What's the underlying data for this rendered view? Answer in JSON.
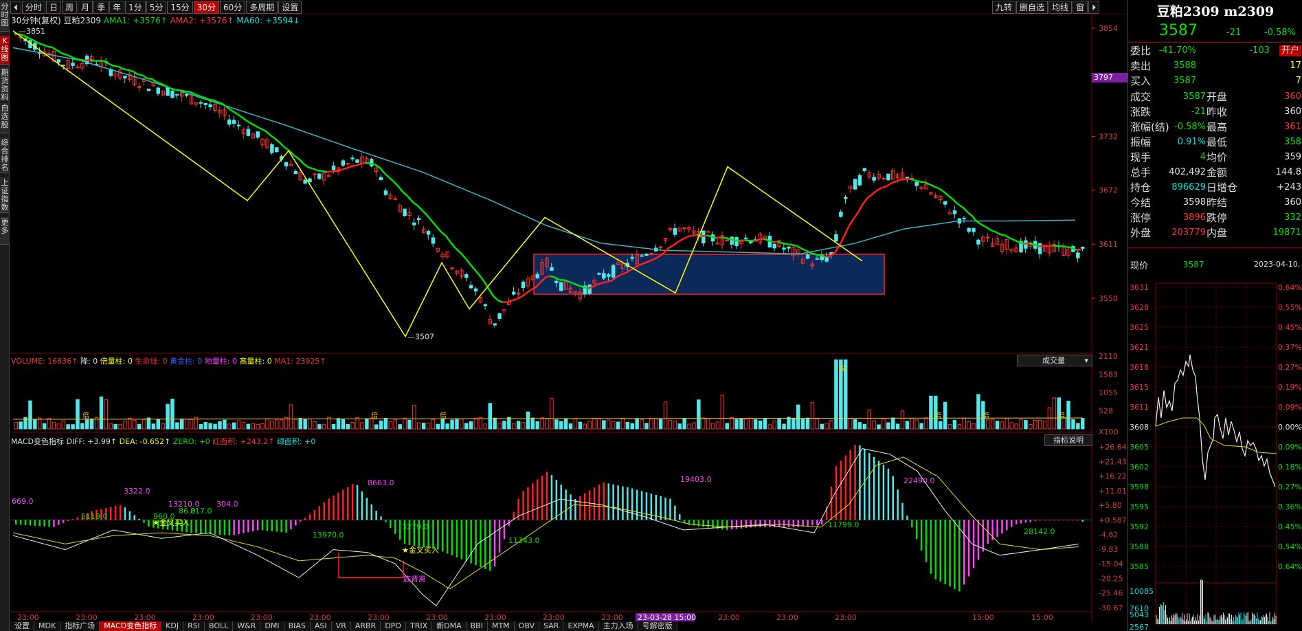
{
  "leftbar": [
    "分时图",
    "K线图",
    "期货资料",
    "自选股",
    "综合排名",
    "上证指数",
    "更多"
  ],
  "toolbar": {
    "arrow_left": "⏴",
    "periods": [
      "分时",
      "日",
      "周",
      "月",
      "季",
      "年",
      "1分",
      "5分",
      "15分",
      "30分",
      "60分",
      "多周期",
      "设置"
    ],
    "active_period": "30分",
    "right_buttons": [
      "九转",
      "删自选",
      "均线",
      "窗",
      "⏵"
    ]
  },
  "main_info": {
    "period_label": "30分钟(复权)",
    "symbol": "豆粕2309",
    "ama1": "AMA1: +3576↑",
    "ama2": "AMA2: +3576↑",
    "ma60": "MA60: +3594↓"
  },
  "price_axis": [
    "3854",
    "3797",
    "3732",
    "3672",
    "3611",
    "3550"
  ],
  "price_tag": "3797",
  "annotations": {
    "high": "3851",
    "low": "3507"
  },
  "volume_info": {
    "volume": "VOLUME: 16836↑",
    "down": "降: 0",
    "double": "倍量柱: 0",
    "life": "生命线: 0",
    "gold": "黄金柱: 0",
    "ground": "地量柱: 0",
    "high": "高量柱: 0",
    "ma1": "MA1: 23925↑"
  },
  "volume_axis": [
    "2110",
    "1583",
    "1055",
    "528",
    "X100"
  ],
  "volume_dropdown": "成交量",
  "volume_marks": {
    "high": "高",
    "double": "倍"
  },
  "macd_info": {
    "title": "MACD变色指标",
    "diff": "DIFF: +3.99↑",
    "dea": "DEA: -0.652↑",
    "zero": "ZERO: +0",
    "red_area": "红面积: +243.2↑",
    "green_area": "绿面积: +0"
  },
  "macd_hint": "指标说明",
  "macd_axis": [
    "+26.64",
    "+21.43",
    "+16.22",
    "+11.01",
    "+5.80",
    "+0.587",
    "-4.62",
    "-9.83",
    "-15.04",
    "-20.25",
    "-25.46",
    "-30.67"
  ],
  "macd_labels": [
    "669.0",
    "3322.0",
    "5119.0",
    "960.0",
    "13210.0",
    "86.0",
    "817.0",
    "304.0",
    "8663.0",
    "3279.0",
    "13970.0",
    "11343.0",
    "19403.0",
    "11799.0",
    "22490.0",
    "28142.0"
  ],
  "macd_signals": [
    "★金叉买入",
    "★金叉买入",
    "底背离"
  ],
  "time_axis": [
    "23:00",
    "23:00",
    "23:00",
    "23:00",
    "23:00",
    "23:00",
    "23:00",
    "23:00",
    "23:00",
    "23:00",
    "23:00",
    "23:00",
    "23:00",
    "23:00",
    "23:00",
    "15:00",
    "15:00",
    "15:00"
  ],
  "time_highlight": "23-03-28 15:00",
  "bottom_tabs": [
    "设置",
    "MDK",
    "指标广场",
    "MACD变色指标",
    "KDJ",
    "RSI",
    "BOLL",
    "W&R",
    "DMI",
    "BIAS",
    "ASI",
    "VR",
    "ARBR",
    "DPO",
    "TRIX",
    "新DMA",
    "BBI",
    "MTM",
    "OBV",
    "SAR",
    "EXPMA",
    "主力入场",
    "号解密版"
  ],
  "active_bottom_tab": "MACD变色指标",
  "quote": {
    "title": "豆粕2309 m2309",
    "price": "3587",
    "change": "-21",
    "change_pct": "-0.58%",
    "rows": [
      {
        "l": "委比",
        "v1": "-41.70%",
        "v2": "-103",
        "v3": "开户"
      },
      {
        "l": "卖出",
        "v1": "3588",
        "v2": "",
        "v3": "17"
      },
      {
        "l": "买入",
        "v1": "3587",
        "v2": "",
        "v3": "7"
      }
    ],
    "stats": [
      {
        "l1": "成交",
        "v1": "3587",
        "l2": "开盘",
        "v2": "360"
      },
      {
        "l1": "涨跌",
        "v1": "-21",
        "l2": "昨收",
        "v2": "360"
      },
      {
        "l1": "涨幅(结)",
        "v1": "-0.58%",
        "l2": "最高",
        "v2": "361"
      },
      {
        "l1": "振幅",
        "v1": "0.91%",
        "l2": "最低",
        "v2": "358"
      },
      {
        "l1": "现手",
        "v1": "4",
        "l2": "均价",
        "v2": "359"
      },
      {
        "l1": "总手",
        "v1": "402,492",
        "l2": "金额",
        "v2": "144.8"
      },
      {
        "l1": "持仓",
        "v1": "896629",
        "l2": "日增仓",
        "v2": "+243"
      },
      {
        "l1": "今结",
        "v1": "3598",
        "l2": "昨结",
        "v2": "360"
      },
      {
        "l1": "涨停",
        "v1": "3896",
        "l2": "跌停",
        "v2": "332"
      },
      {
        "l1": "外盘",
        "v1": "203779",
        "l2": "内盘",
        "v2": "19871"
      }
    ],
    "now_label": "现价",
    "now_price": "3587",
    "now_date": "2023-04-10,"
  },
  "intraday": {
    "price_axis": [
      "3631",
      "3628",
      "3625",
      "3621",
      "3618",
      "3615",
      "3611",
      "3608",
      "3605",
      "3602",
      "3598",
      "3595",
      "3592",
      "3588",
      "3585"
    ],
    "pct_axis": [
      "0.64%",
      "0.55%",
      "0.45%",
      "0.37%",
      "0.27%",
      "0.19%",
      "0.09%",
      "0.00%",
      "0.09%",
      "0.18%",
      "0.27%",
      "0.36%",
      "0.45%",
      "0.54%",
      "0.64%"
    ],
    "vol_axis": [
      "10085",
      "7610",
      "5043",
      "2567"
    ]
  },
  "colors": {
    "up": "#ff3030",
    "down": "#50e8e8",
    "ama1": "#00e000",
    "ama2": "#ff2020",
    "ma60": "#30b8c8",
    "zigzag": "#ffff00",
    "box_fill": "#0b2a5a",
    "box_border": "#ff2020"
  }
}
